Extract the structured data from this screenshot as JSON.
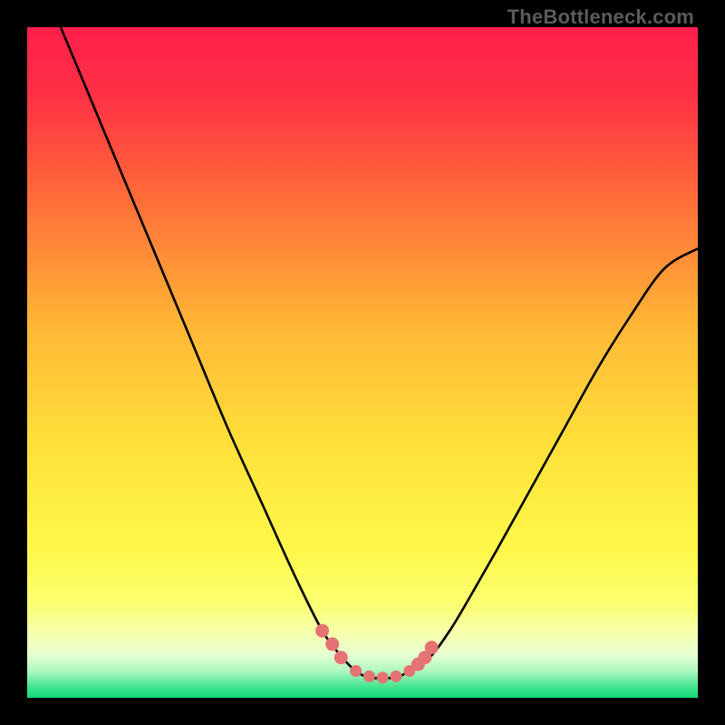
{
  "watermark": "TheBottleneck.com",
  "colors": {
    "frame": "#000000",
    "curve": "#000000",
    "marker": "#e57373",
    "gradient_stops": [
      {
        "offset": 0.0,
        "color": "#ff1f4b"
      },
      {
        "offset": 0.1,
        "color": "#ff3045"
      },
      {
        "offset": 0.25,
        "color": "#ff6a39"
      },
      {
        "offset": 0.45,
        "color": "#ffb836"
      },
      {
        "offset": 0.62,
        "color": "#ffe03a"
      },
      {
        "offset": 0.78,
        "color": "#fff84a"
      },
      {
        "offset": 0.86,
        "color": "#fbff72"
      },
      {
        "offset": 0.905,
        "color": "#f6ffae"
      },
      {
        "offset": 0.935,
        "color": "#e8ffd2"
      },
      {
        "offset": 0.96,
        "color": "#aef7c0"
      },
      {
        "offset": 0.985,
        "color": "#3de48e"
      },
      {
        "offset": 1.0,
        "color": "#15d87a"
      }
    ]
  },
  "chart_data": {
    "type": "line",
    "title": "",
    "xlabel": "",
    "ylabel": "",
    "xlim": [
      0,
      100
    ],
    "ylim": [
      0,
      100
    ],
    "series": [
      {
        "name": "bottleneck-curve",
        "x": [
          5,
          10,
          15,
          20,
          25,
          30,
          35,
          40,
          44,
          47,
          49,
          51,
          53,
          55,
          57,
          60,
          63,
          66,
          70,
          75,
          80,
          85,
          90,
          95,
          100
        ],
        "y": [
          100,
          88,
          76,
          64,
          52,
          40,
          29,
          18,
          10,
          6,
          4,
          3,
          3,
          3,
          4,
          6,
          10,
          15,
          22,
          31,
          40,
          49,
          57,
          64,
          67
        ]
      }
    ],
    "markers": {
      "name": "highlight-points",
      "x": [
        44.0,
        45.5,
        46.8,
        49.0,
        51.0,
        53.0,
        55.0,
        57.0,
        58.3,
        59.3,
        60.3
      ],
      "y": [
        10.0,
        8.0,
        6.0,
        4.0,
        3.2,
        3.0,
        3.2,
        4.0,
        5.0,
        6.0,
        7.5
      ]
    }
  }
}
